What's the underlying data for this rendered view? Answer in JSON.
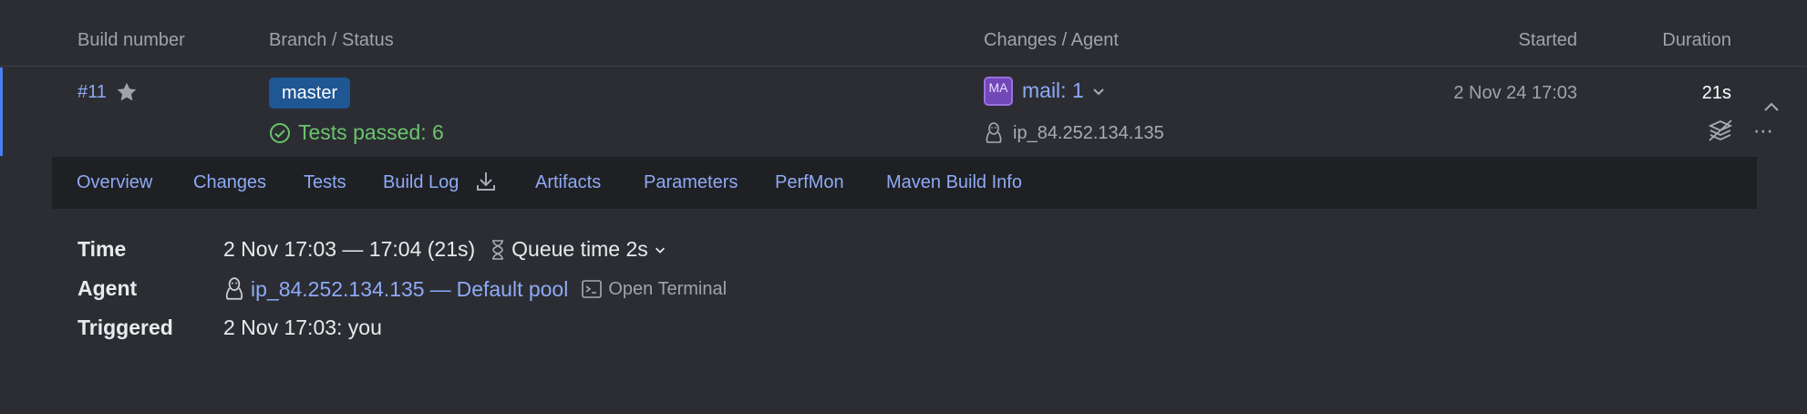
{
  "columns": {
    "build_number": "Build number",
    "branch_status": "Branch / Status",
    "changes_agent": "Changes / Agent",
    "started": "Started",
    "duration": "Duration"
  },
  "build": {
    "number": "#11",
    "branch": "master",
    "status": "Tests passed: 6",
    "changes_avatar": "MA",
    "changes": "mail: 1",
    "agent": "ip_84.252.134.135",
    "started": "2 Nov 24 17:03",
    "duration": "21s"
  },
  "tabs": [
    "Overview",
    "Changes",
    "Tests",
    "Build Log",
    "Artifacts",
    "Parameters",
    "PerfMon",
    "Maven Build Info"
  ],
  "details": {
    "time_label": "Time",
    "time_value": "2 Nov 17:03 — 17:04 (21s)",
    "queue_time": "Queue time 2s",
    "agent_label": "Agent",
    "agent_name": "ip_84.252.134.135",
    "separator": "—",
    "pool": "Default pool",
    "open_terminal": "Open Terminal",
    "triggered_label": "Triggered",
    "triggered_value": "2 Nov 17:03: you"
  },
  "colors": {
    "background": "#2b2d33",
    "link": "#8eaaf5",
    "success": "#6bc46d",
    "branch_badge": "#1f5694",
    "accent": "#4a7ff0"
  }
}
